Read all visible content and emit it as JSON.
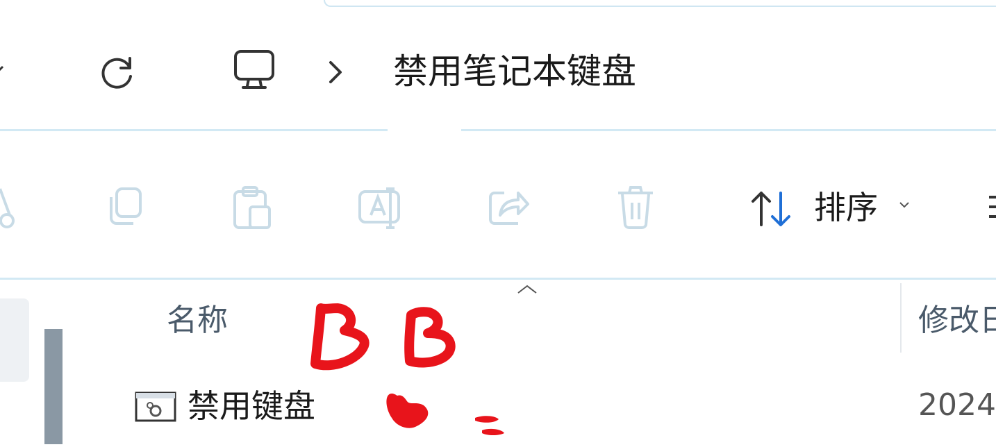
{
  "address_bar": {
    "crumb_title": "禁用笔记本键盘",
    "separator": "›"
  },
  "toolbar": {
    "sort_label": "排序",
    "tools": [
      "cut-icon",
      "copy-icon",
      "paste-icon",
      "rename-icon",
      "share-icon",
      "delete-icon"
    ]
  },
  "file_list": {
    "columns": {
      "name": "名称",
      "modified": "修改日"
    },
    "rows": [
      {
        "name": "禁用键盘",
        "modified": "2024"
      }
    ]
  },
  "annotations": {
    "scribble_text": "B B"
  },
  "colors": {
    "separator": "#d2e9f4",
    "disabled_icon": "#c8dbe6",
    "accent_blue": "#1f6fd6",
    "scribble_red": "#e8141b"
  }
}
